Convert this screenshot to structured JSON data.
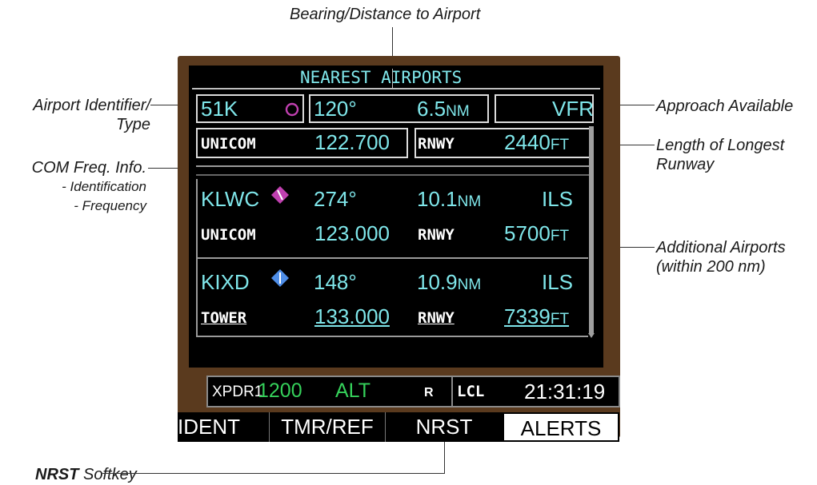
{
  "callouts": {
    "bearing_distance": "Bearing/Distance to Airport",
    "airport_identifier_line1": "Airport Identifier/",
    "airport_identifier_line2": "Type",
    "com_freq_line1": "COM Freq. Info.",
    "com_freq_line2": "- Identification",
    "com_freq_line3": "- Frequency",
    "approach_available": "Approach Available",
    "longest_runway_line1": "Length of Longest",
    "longest_runway_line2": "Runway",
    "additional_airports_line1": "Additional Airports",
    "additional_airports_line2": "(within 200 nm)",
    "nrst_softkey_bold": "NRST",
    "nrst_softkey_rest": " Softkey"
  },
  "screen": {
    "title": "NEAREST AIRPORTS",
    "airports": [
      {
        "ident": "51K",
        "symbol": "airport-nontowered-circle-icon",
        "bearing": "120°",
        "distance": "6.5",
        "distance_unit": "NM",
        "approach": "VFR",
        "freq_label": "UNICOM",
        "freq": "122.700",
        "rnwy_label": "RNWY",
        "rnwy_length": "2440",
        "rnwy_unit": "FT"
      },
      {
        "ident": "KLWC",
        "symbol": "airport-soft-surface-icon",
        "bearing": "274°",
        "distance": "10.1",
        "distance_unit": "NM",
        "approach": "ILS",
        "freq_label": "UNICOM",
        "freq": "123.000",
        "rnwy_label": "RNWY",
        "rnwy_length": "5700",
        "rnwy_unit": "FT"
      },
      {
        "ident": "KIXD",
        "symbol": "airport-towered-icon",
        "bearing": "148°",
        "distance": "10.9",
        "distance_unit": "NM",
        "approach": "ILS",
        "freq_label": "TOWER",
        "freq": "133.000",
        "rnwy_label": "RNWY",
        "rnwy_length": "7339",
        "rnwy_unit": "FT"
      }
    ]
  },
  "status_bar": {
    "xpdr_label": "XPDR1",
    "squawk": "1200",
    "mode": "ALT",
    "reply": "R",
    "time_label": "LCL",
    "time": "21:31:19"
  },
  "softkeys": [
    "IDENT",
    "TMR/REF",
    "NRST",
    "ALERTS"
  ],
  "colors": {
    "cyan": "#7fe6ea",
    "green": "#35d05a",
    "bezel": "#5a3a1e",
    "magenta_symbol": "#c040b0",
    "blue_symbol": "#4f8ee8"
  }
}
